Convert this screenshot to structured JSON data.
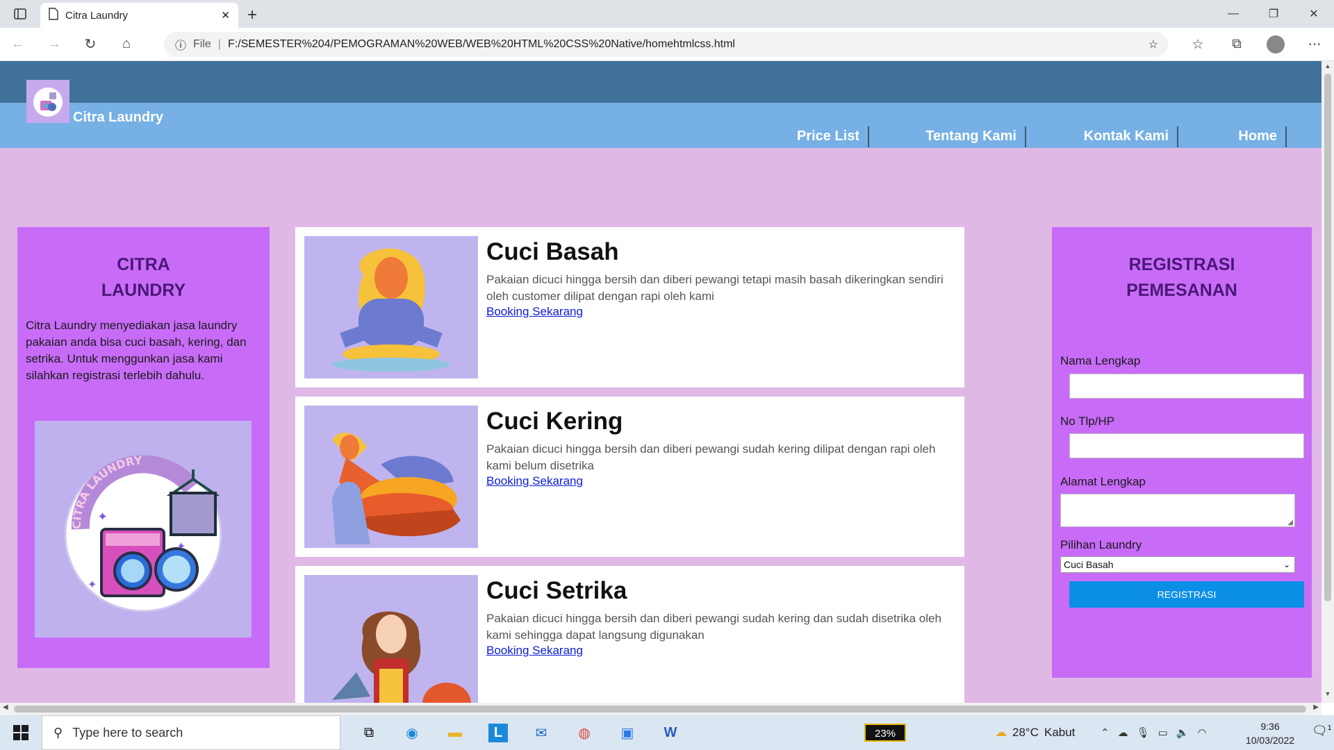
{
  "browser": {
    "tab_title": "Citra Laundry",
    "address_label": "File",
    "url": "F:/SEMESTER%204/PEMOGRAMAN%20WEB/WEB%20HTML%20CSS%20Native/homehtmlcss.html"
  },
  "site": {
    "brand": "Citra Laundry",
    "nav": [
      "Price List",
      "Tentang Kami",
      "Kontak Kami",
      "Home"
    ],
    "left_title_line1": "CITRA",
    "left_title_line2": "LAUNDRY",
    "left_text": "Citra Laundry menyediakan jasa laundry pakaian anda bisa cuci basah, kering, dan setrika. Untuk menggunkan jasa kami silahkan registrasi terlebih dahulu.",
    "logo_text": "CITRA LAUNDRY",
    "services": [
      {
        "title": "Cuci Basah",
        "desc": "Pakaian dicuci hingga bersih dan diberi pewangi tetapi masih basah dikeringkan sendiri oleh customer dilipat dengan rapi oleh kami",
        "link": "Booking Sekarang"
      },
      {
        "title": "Cuci Kering",
        "desc": "Pakaian dicuci hingga bersih dan diberi pewangi sudah kering dilipat dengan rapi oleh kami belum disetrika",
        "link": "Booking Sekarang"
      },
      {
        "title": "Cuci Setrika",
        "desc": "Pakaian dicuci hingga bersih dan diberi pewangi sudah kering dan sudah disetrika oleh kami sehingga dapat langsung digunakan",
        "link": "Booking Sekarang"
      }
    ],
    "form": {
      "title_line1": "REGISTRASI",
      "title_line2": "PEMESANAN",
      "name_label": "Nama Lengkap",
      "phone_label": "No Tlp/HP",
      "address_label": "Alamat Lengkap",
      "choice_label": "Pilihan Laundry",
      "choice_value": "Cuci Basah",
      "submit": "REGISTRASI"
    }
  },
  "taskbar": {
    "search_placeholder": "Type here to search",
    "battery": "23%",
    "temperature": "28°C",
    "weather": "Kabut",
    "time": "9:36",
    "date": "10/03/2022",
    "notif_count": "1"
  },
  "colors": {
    "header_top": "#40719a",
    "header_nav": "#76b0e4",
    "page_bg": "#dfb8e6",
    "card_bg": "#c86cf8",
    "button": "#0a8ee6"
  }
}
